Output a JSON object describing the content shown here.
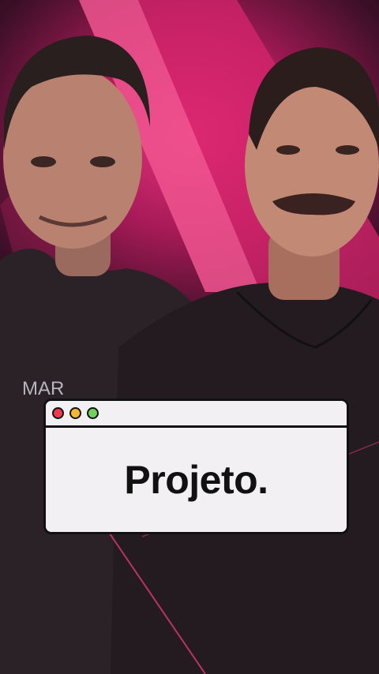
{
  "background": {
    "description_icon": "video-frame-icon",
    "shirt_logo_text": "MAR"
  },
  "popup": {
    "buttons": {
      "close_color": "#ee3a4e",
      "minimize_color": "#f6b92a",
      "maximize_color": "#6fd35a"
    },
    "text": "Projeto."
  }
}
